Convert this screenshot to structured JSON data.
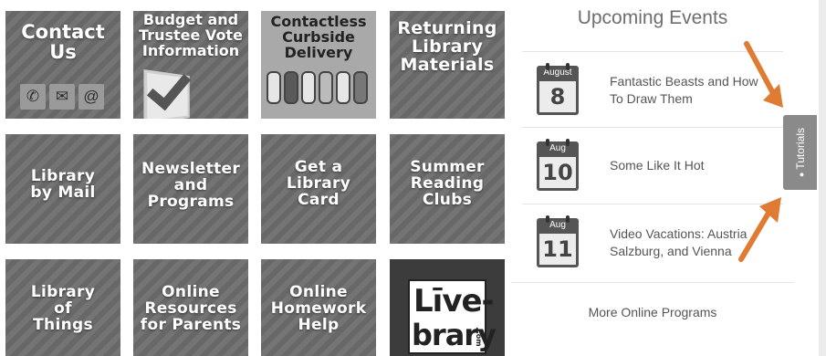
{
  "tiles": [
    {
      "label": "Contact\nUs"
    },
    {
      "label": "Budget and\nTrustee Vote\nInformation"
    },
    {
      "label": "Contactless\nCurbside\nDelivery"
    },
    {
      "label": "Returning\nLibrary\nMaterials"
    },
    {
      "label": "Library\nby Mail"
    },
    {
      "label": "Newsletter\nand\nPrograms"
    },
    {
      "label": "Get a\nLibrary\nCard"
    },
    {
      "label": "Summer\nReading\nClubs"
    },
    {
      "label": "Library\nof\nThings"
    },
    {
      "label": "Online\nResources\nfor Parents"
    },
    {
      "label": "Online\nHomework\nHelp"
    },
    {
      "label": "Livebrary"
    }
  ],
  "livebrary_logo": {
    "line1": "Līve-",
    "line2": "brary",
    "suffix": ".com"
  },
  "events": {
    "title": "Upcoming Events",
    "items": [
      {
        "month": "August",
        "day": "8",
        "title": "Fantastic Beasts and How\nTo Draw Them"
      },
      {
        "month": "Aug",
        "day": "10",
        "title": "Some Like It Hot"
      },
      {
        "month": "Aug",
        "day": "11",
        "title": "Video Vacations: Austria\nSalzburg, and Vienna"
      }
    ],
    "more_label": "More Online Programs"
  },
  "tutorials": {
    "label": "Tutorials"
  },
  "colors": {
    "tile": "#6d6d6d",
    "accent_arrow": "#e07b33",
    "tab": "#8a8a8a"
  }
}
